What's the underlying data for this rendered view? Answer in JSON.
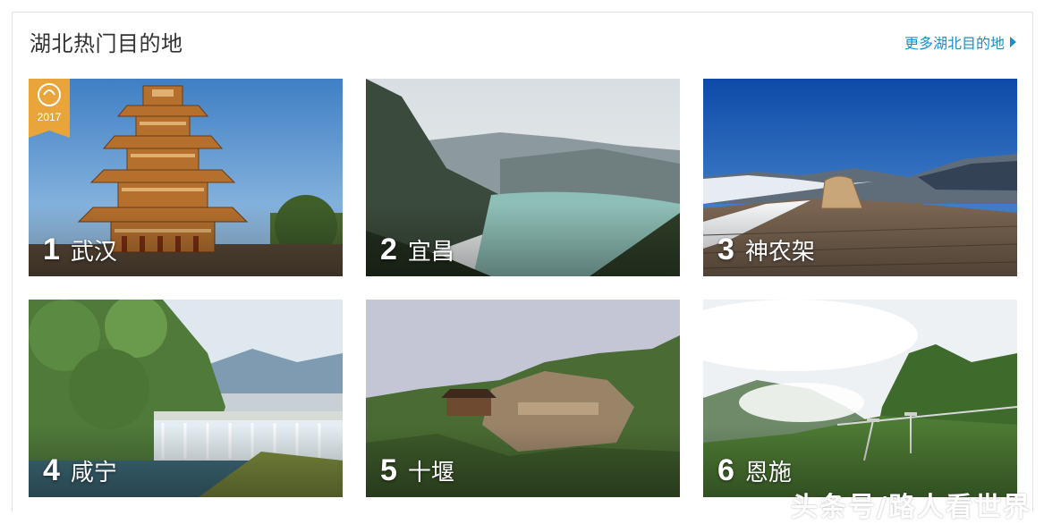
{
  "section": {
    "title": "湖北热门目的地",
    "more_label": "更多湖北目的地"
  },
  "badge": {
    "year": "2017"
  },
  "destinations": [
    {
      "rank": "1",
      "name": "武汉"
    },
    {
      "rank": "2",
      "name": "宜昌"
    },
    {
      "rank": "3",
      "name": "神农架"
    },
    {
      "rank": "4",
      "name": "咸宁"
    },
    {
      "rank": "5",
      "name": "十堰"
    },
    {
      "rank": "6",
      "name": "恩施"
    }
  ],
  "watermark": "头条号/路人看世界",
  "colors": {
    "link": "#1a8ec9",
    "badge": "#e9a53a",
    "title": "#333333"
  }
}
